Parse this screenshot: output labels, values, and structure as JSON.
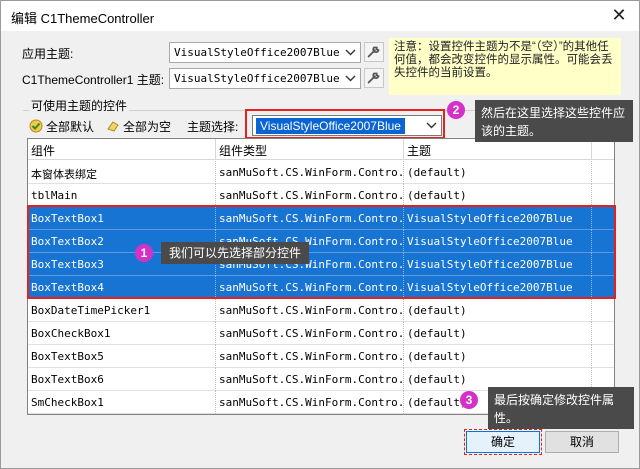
{
  "window": {
    "title": "编辑 C1ThemeController",
    "close_glyph": "✕"
  },
  "app_theme": {
    "label": "应用主题:",
    "value": "VisualStyleOffice2007Blue"
  },
  "controller_theme": {
    "label": "C1ThemeController1 主题:",
    "value": "VisualStyleOffice2007Blue"
  },
  "note": {
    "text": "注意：设置控件主题为不是“（空）”的其他任何值，都会改变控件的显示属性。可能会丢失控件的当前设置。"
  },
  "group": {
    "title": "可使用主题的控件"
  },
  "toolbar": {
    "all_default_label": "全部默认",
    "all_empty_label": "全部为空",
    "theme_select_label": "主题选择:",
    "theme_select_value": "VisualStyleOffice2007Blue"
  },
  "grid": {
    "columns": [
      "组件",
      "组件类型",
      "主题"
    ],
    "rows": [
      {
        "component": "本窗体表绑定",
        "type": "sanMuSoft.CS.WinForm.Contro...",
        "theme": "(default)",
        "selected": false
      },
      {
        "component": "tblMain",
        "type": "sanMuSoft.CS.WinForm.Contro...",
        "theme": "(default)",
        "selected": false
      },
      {
        "component": "BoxTextBox1",
        "type": "sanMuSoft.CS.WinForm.Contro...",
        "theme": "VisualStyleOffice2007Blue",
        "selected": true
      },
      {
        "component": "BoxTextBox2",
        "type": "sanMuSoft.CS.WinForm.Contro...",
        "theme": "VisualStyleOffice2007Blue",
        "selected": true
      },
      {
        "component": "BoxTextBox3",
        "type": "sanMuSoft.CS.WinForm.Contro...",
        "theme": "VisualStyleOffice2007Blue",
        "selected": true
      },
      {
        "component": "BoxTextBox4",
        "type": "sanMuSoft.CS.WinForm.Contro...",
        "theme": "VisualStyleOffice2007Blue",
        "selected": true
      },
      {
        "component": "BoxDateTimePicker1",
        "type": "sanMuSoft.CS.WinForm.Contro...",
        "theme": "(default)",
        "selected": false
      },
      {
        "component": "BoxCheckBox1",
        "type": "sanMuSoft.CS.WinForm.Contro...",
        "theme": "(default)",
        "selected": false
      },
      {
        "component": "BoxTextBox5",
        "type": "sanMuSoft.CS.WinForm.Contro...",
        "theme": "(default)",
        "selected": false
      },
      {
        "component": "BoxTextBox6",
        "type": "sanMuSoft.CS.WinForm.Contro...",
        "theme": "(default)",
        "selected": false
      },
      {
        "component": "SmCheckBox1",
        "type": "sanMuSoft.CS.WinForm.Contro...",
        "theme": "(default)",
        "selected": false
      }
    ]
  },
  "annotations": [
    {
      "number": "1",
      "text": "我们可以先选择部分控件"
    },
    {
      "number": "2",
      "text": "然后在这里选择这些控件应该的主题。"
    },
    {
      "number": "3",
      "text": "最后按确定修改控件属性。"
    }
  ],
  "buttons": {
    "ok": "确定",
    "cancel": "取消"
  },
  "colors": {
    "selection": "#1874d2",
    "badge": "#d431c8",
    "callout": "#4a4a4a",
    "highlight": "#e8201c",
    "note_bg": "#ffffc8"
  }
}
